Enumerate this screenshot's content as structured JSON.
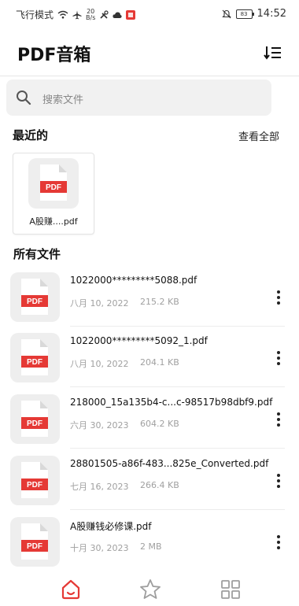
{
  "status_bar": {
    "left_text": "飞行模式",
    "speed_value": "20",
    "speed_unit": "B/s",
    "battery": "83",
    "time": "14:52"
  },
  "app": {
    "title": "PDF音箱"
  },
  "search": {
    "placeholder": "搜索文件"
  },
  "recent": {
    "section_title": "最近的",
    "view_all_label": "查看全部",
    "items": [
      {
        "name": "A股赚....pdf",
        "badge": "PDF"
      }
    ]
  },
  "all_files": {
    "section_title": "所有文件",
    "items": [
      {
        "badge": "PDF",
        "name": "1022000*********5088.pdf",
        "date": "八月 10, 2022",
        "size": "215.2 KB"
      },
      {
        "badge": "PDF",
        "name": "1022000*********5092_1.pdf",
        "date": "八月 10, 2022",
        "size": "204.1 KB"
      },
      {
        "badge": "PDF",
        "name": "218000_15a135b4-c...c-98517b98dbf9.pdf",
        "date": "六月 30, 2023",
        "size": "604.2 KB"
      },
      {
        "badge": "PDF",
        "name": "28801505-a86f-483...825e_Converted.pdf",
        "date": "七月 16, 2023",
        "size": "266.4 KB"
      },
      {
        "badge": "PDF",
        "name": "A股赚钱必修课.pdf",
        "date": "十月 30, 2023",
        "size": "2 MB"
      }
    ]
  },
  "colors": {
    "accent": "#e53935",
    "pdf_badge": "#e53935",
    "muted_text": "#a0a0a0",
    "icon_gray": "#9e9e9e"
  },
  "bottom_nav": {
    "items": [
      {
        "icon": "home-icon",
        "active": true
      },
      {
        "icon": "star-icon",
        "active": false
      },
      {
        "icon": "grid-icon",
        "active": false
      }
    ]
  }
}
